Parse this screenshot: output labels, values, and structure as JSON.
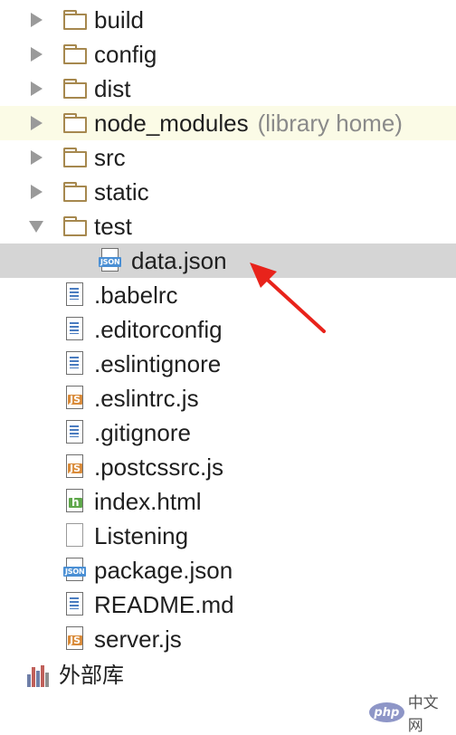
{
  "tree": {
    "folders": [
      {
        "label": "build",
        "hint": "",
        "expanded": false
      },
      {
        "label": "config",
        "hint": "",
        "expanded": false
      },
      {
        "label": "dist",
        "hint": "",
        "expanded": false
      },
      {
        "label": "node_modules",
        "hint": "(library home)",
        "expanded": false
      },
      {
        "label": "src",
        "hint": "",
        "expanded": false
      },
      {
        "label": "static",
        "hint": "",
        "expanded": false
      },
      {
        "label": "test",
        "hint": "",
        "expanded": true
      }
    ],
    "test_children": [
      {
        "label": "data.json",
        "icon": "json-file-icon",
        "badge": "JSON",
        "selected": true
      }
    ],
    "files": [
      {
        "label": ".babelrc",
        "icon": "text-file-icon",
        "badge": ""
      },
      {
        "label": ".editorconfig",
        "icon": "text-file-icon",
        "badge": ""
      },
      {
        "label": ".eslintignore",
        "icon": "text-file-icon",
        "badge": ""
      },
      {
        "label": ".eslintrc.js",
        "icon": "js-file-icon",
        "badge": "JS"
      },
      {
        "label": ".gitignore",
        "icon": "text-file-icon",
        "badge": ""
      },
      {
        "label": ".postcssrc.js",
        "icon": "js-file-icon",
        "badge": "JS"
      },
      {
        "label": "index.html",
        "icon": "html-file-icon",
        "badge": "h"
      },
      {
        "label": "Listening",
        "icon": "blank-file-icon",
        "badge": ""
      },
      {
        "label": "package.json",
        "icon": "json-file-icon",
        "badge": "JSON"
      },
      {
        "label": "README.md",
        "icon": "text-file-icon",
        "badge": ""
      },
      {
        "label": "server.js",
        "icon": "js-file-icon",
        "badge": "JS"
      }
    ],
    "external_libraries": "外部库"
  },
  "colors": {
    "folder": "#a6884e",
    "selection": "#d5d5d5",
    "library_home_row": "#fbfbe6",
    "annotation_arrow": "#e8231b"
  },
  "watermark": {
    "logo": "php",
    "text": "中文网"
  }
}
